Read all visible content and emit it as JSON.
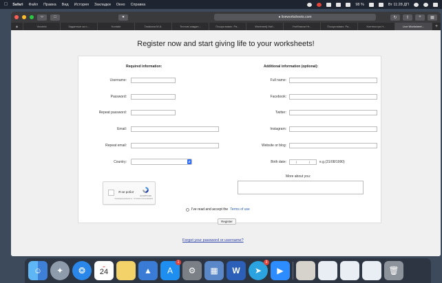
{
  "menubar": {
    "app": "Safari",
    "items": [
      "Файл",
      "Правка",
      "Вид",
      "История",
      "Закладки",
      "Окно",
      "Справка"
    ],
    "battery": "98 %",
    "clock": "Вт 11:28 ДП"
  },
  "browser": {
    "url": "liveworksheets.com",
    "tabs": [
      "Vezdeki",
      "Заданные за н...",
      "Kontakt",
      "Tarakana M.A.",
      "Тестові завдан...",
      "Пошук вивих. Ра...",
      "Wortmeeij Hat!..",
      "Учебникчи Hr...",
      "Пошук вивих. Ра...",
      "Контекстуя Н...",
      "Live Worksheet..."
    ],
    "active_tab_index": 10
  },
  "page": {
    "headline": "Register now and start giving life to your worksheets!",
    "required_heading": "Required information:",
    "additional_heading": "Additional information (optional):",
    "required_fields": {
      "username": "Username:",
      "password": "Password:",
      "repeat_password": "Repeat password:",
      "email": "Email:",
      "repeat_email": "Repeat email:",
      "country": "Country:"
    },
    "additional_fields": {
      "full_name": "Full name:",
      "facebook": "Facebook:",
      "twitter": "Twitter:",
      "instagram": "Instagram:",
      "website": "Website or blog:",
      "birth_date": "Birth date:",
      "birth_date_hint": "e.g.(31/08/1990)",
      "more_about": "More about you:"
    },
    "captcha": {
      "label": "Я не робот",
      "brand": "reCAPTCHA",
      "links": "Конфиденциальность - Условия использования"
    },
    "agree_text": "I've read and accept the",
    "terms_link": "Terms of use",
    "register_button": "Register",
    "forgot_link": "Forgot your password or username?"
  },
  "dock": {
    "calendar_day": "24",
    "telegram_badge": "3",
    "app_store_badge": "1",
    "icons": [
      "finder-icon",
      "launchpad-icon",
      "safari-icon",
      "calendar-icon",
      "notes-icon",
      "keynote-icon",
      "app-store-icon",
      "system-preferences-icon",
      "preview-icon",
      "word-icon",
      "telegram-icon",
      "zoom-icon",
      "files-icon",
      "window-icon",
      "window-icon",
      "window-icon",
      "trash-icon"
    ]
  },
  "colors": {
    "accent_blue": "#2f6df6",
    "link_blue": "#2a5db0",
    "window_dark": "#3a3a3c"
  }
}
